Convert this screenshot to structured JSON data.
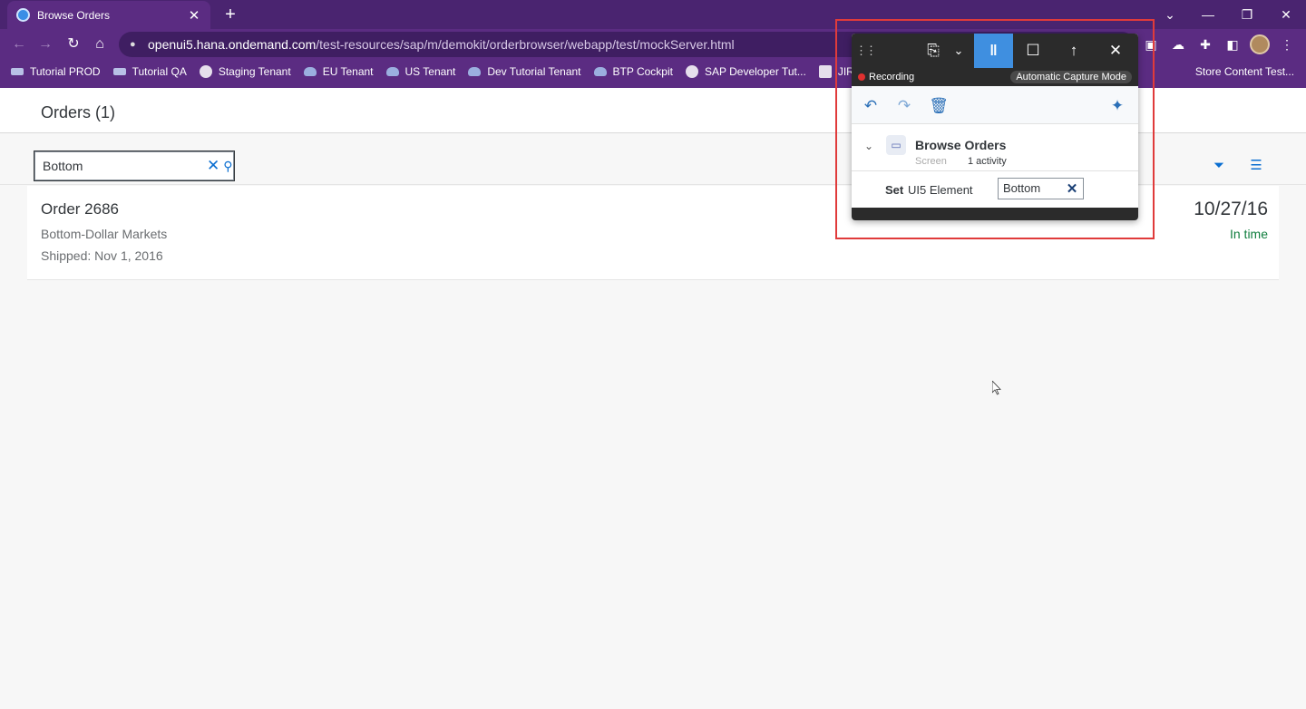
{
  "browser": {
    "tab_title": "Browse Orders",
    "tab_close": "✕",
    "new_tab": "+",
    "url_host": "openui5.hana.ondemand.com",
    "url_path": "/test-resources/sap/m/demokit/orderbrowser/webapp/test/mockServer.html",
    "bookmarks": [
      {
        "label": "Tutorial PROD"
      },
      {
        "label": "Tutorial QA"
      },
      {
        "label": "Staging Tenant"
      },
      {
        "label": "EU Tenant"
      },
      {
        "label": "US Tenant"
      },
      {
        "label": "Dev Tutorial Tenant"
      },
      {
        "label": "BTP Cockpit"
      },
      {
        "label": "SAP Developer Tut..."
      },
      {
        "label": "JIRA Boa"
      },
      {
        "label": "Store Content Test..."
      }
    ]
  },
  "app": {
    "title": "Orders (1)",
    "search_value": "Bottom",
    "orders": [
      {
        "name": "Order 2686",
        "customer": "Bottom-Dollar Markets",
        "shipped": "Shipped: Nov 1, 2016",
        "date": "10/27/16",
        "status": "In time"
      }
    ]
  },
  "recorder": {
    "status_label": "Recording",
    "mode_label": "Automatic Capture Mode",
    "screen_name": "Browse Orders",
    "screen_type": "Screen",
    "activity_count": "1 activity",
    "step_verb": "Set",
    "step_target": "UI5 Element",
    "step_value": "Bottom"
  },
  "colors": {
    "browser_chrome": "#5b2c82",
    "accent": "#0a6ed1",
    "status_ok": "#107e3e",
    "highlight": "#e03b3b",
    "recorder_bar": "#2b2b2b",
    "pause_active": "#3f8fe0"
  }
}
